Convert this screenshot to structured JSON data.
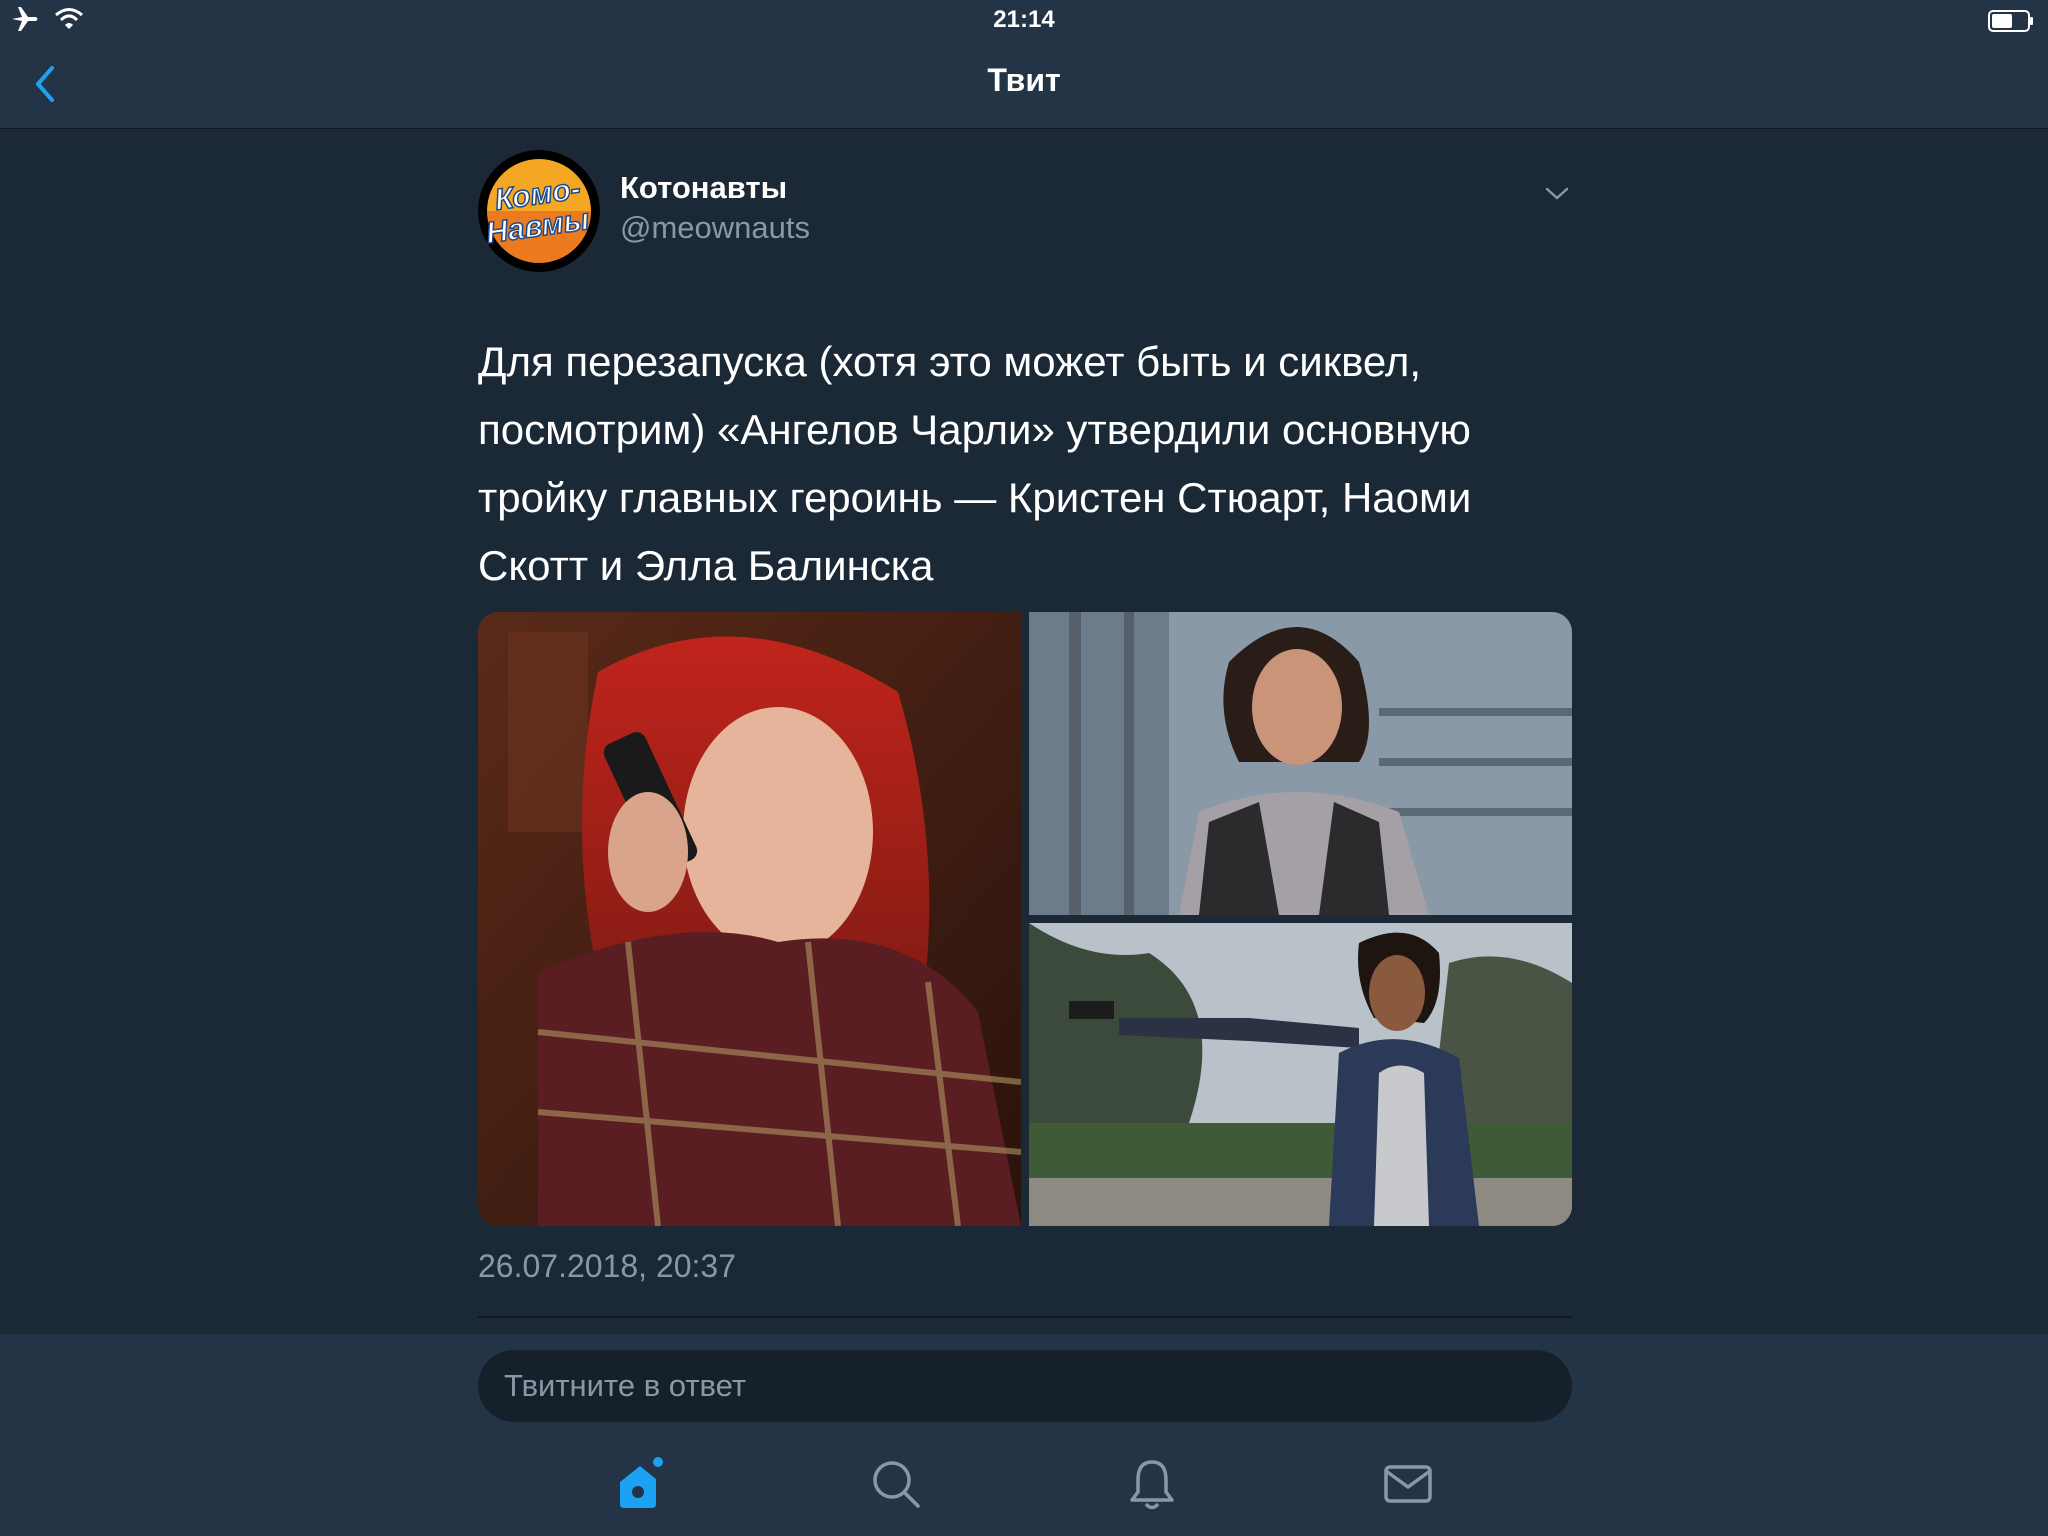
{
  "status": {
    "time": "21:14",
    "icons": [
      "airplane-icon",
      "wifi-icon",
      "battery-icon"
    ]
  },
  "nav": {
    "title": "Твит",
    "back_icon": "chevron-left-icon"
  },
  "tweet": {
    "author_name": "Котонавты",
    "author_handle": "@meownauts",
    "avatar_text": [
      "Комо-",
      "Навмы"
    ],
    "text_lines": [
      "Для перезапуска (хотя это может быть и сиквел,",
      "посмотрим) «Ангелов Чарли» утвердили основную",
      "тройку главных героинь — Кристен Стюарт, Наоми",
      "Скотт и Элла Балинска"
    ],
    "timestamp": "26.07.2018, 20:37"
  },
  "reply": {
    "placeholder": "Твитните в ответ"
  },
  "tabbar": {
    "items": [
      "home-icon",
      "search-icon",
      "notifications-icon",
      "messages-icon"
    ],
    "accent": "#1da1f2"
  },
  "colors": {
    "background": "#1b2836",
    "bar": "#243447",
    "secondary_text": "#8899a6",
    "accent": "#1da1f2"
  }
}
